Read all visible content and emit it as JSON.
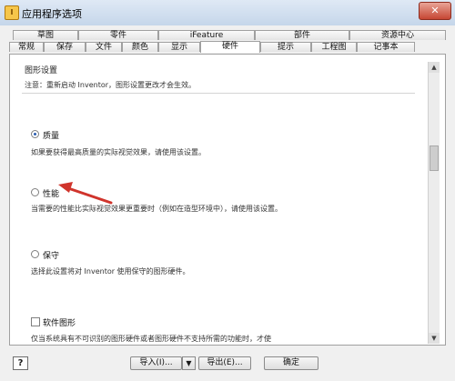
{
  "window": {
    "title": "应用程序选项",
    "close_glyph": "✕"
  },
  "tabs": {
    "row1": [
      "草图",
      "零件",
      "iFeature",
      "部件",
      "资源中心"
    ],
    "row2": [
      "常规",
      "保存",
      "文件",
      "颜色",
      "显示",
      "硬件",
      "提示",
      "工程图",
      "记事本"
    ],
    "active": "硬件"
  },
  "graphics": {
    "group_title": "图形设置",
    "note": "注意：重新启动 Inventor，图形设置更改才会生效。",
    "options": [
      {
        "label": "质量",
        "desc": "如果要获得最高质量的实际视觉效果，请使用该设置。",
        "checked": true
      },
      {
        "label": "性能",
        "desc": "当需要的性能比实际视觉效果更重要时（例如在造型环境中），请使用该设置。",
        "checked": false
      },
      {
        "label": "保守",
        "desc": "选择此设置将对 Inventor 使用保守的图形硬件。",
        "checked": false
      }
    ],
    "software": {
      "label": "软件图形",
      "desc": "仅当系统具有不可识别的图形硬件或者图形硬件不支持所需的功能时，才使",
      "checked": false
    }
  },
  "footer": {
    "help": "?",
    "import": "导入(I)...",
    "export": "导出(E)...",
    "ok": "确定"
  }
}
